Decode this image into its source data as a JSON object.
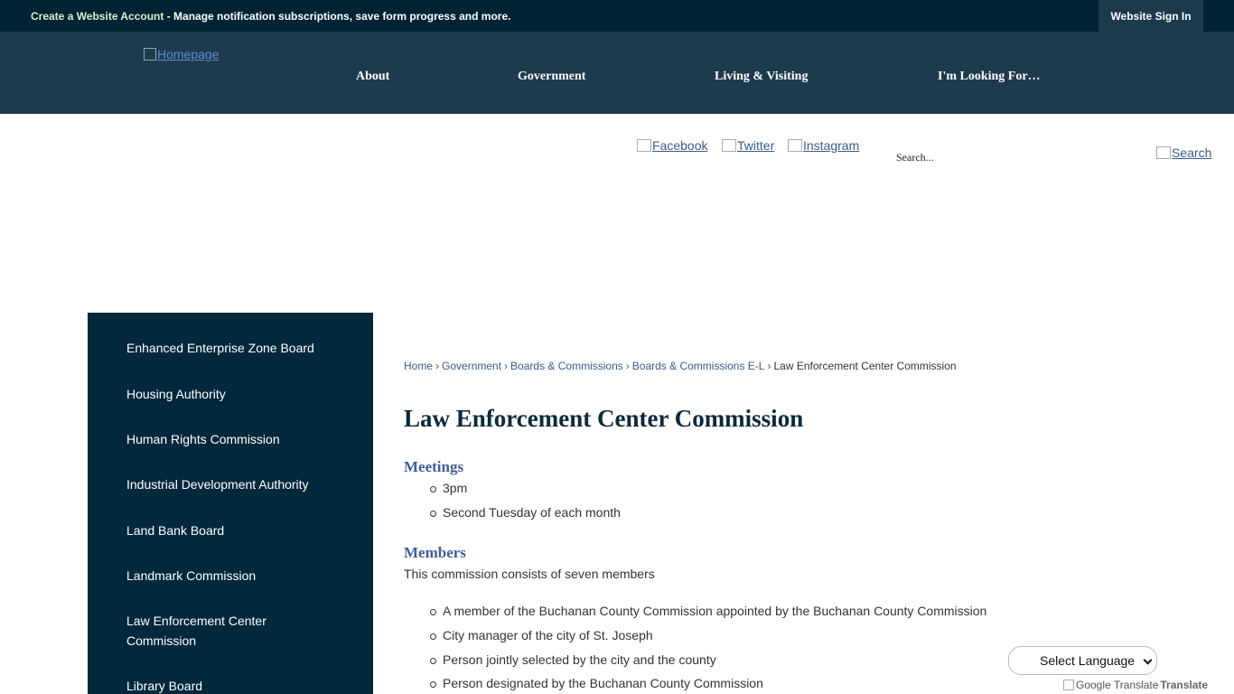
{
  "topbar": {
    "account_link": "Create a Website Account",
    "message": " - Manage notification subscriptions, save form progress and more.",
    "signin_label": "Website Sign In"
  },
  "header": {
    "logo_alt": "Homepage",
    "nav": [
      "About",
      "Government",
      "Living & Visiting",
      "I'm Looking For…"
    ]
  },
  "social": {
    "facebook": "Facebook",
    "twitter": "Twitter",
    "instagram": "Instagram"
  },
  "search": {
    "placeholder": "Search...",
    "button_alt": "Search"
  },
  "sidebar": {
    "items": [
      "Enhanced Enterprise Zone Board",
      "Housing Authority",
      "Human Rights Commission",
      "Industrial Development Authority",
      "Land Bank Board",
      "Landmark Commission",
      "Law Enforcement Center Commission",
      "Library Board"
    ]
  },
  "breadcrumb": {
    "items": [
      "Home",
      "Government",
      "Boards & Commissions",
      "Boards & Commissions E-L"
    ],
    "current": "Law Enforcement Center Commission",
    "separator": "›"
  },
  "main": {
    "title": "Law Enforcement Center Commission",
    "meetings_heading": "Meetings",
    "meetings": [
      "3pm",
      "Second Tuesday of each month"
    ],
    "members_heading": "Members",
    "members_intro": "This commission consists of seven members",
    "members": [
      "A member of the Buchanan County Commission appointed by the Buchanan County Commission",
      "City manager of the city of St. Joseph",
      "Person jointly selected by the city and the county",
      "Person designated by the Buchanan County Commission"
    ]
  },
  "translate": {
    "select_label": "Select Language",
    "credit_alt": "Google Translate",
    "credit_text": "Translate"
  },
  "colors": {
    "topbar_bg": "#012335",
    "header_bg": "#1d3a4e",
    "sidebar_bg": "#02283c",
    "heading_blue": "#3e5d9a",
    "title_color": "#0b2a3c"
  }
}
